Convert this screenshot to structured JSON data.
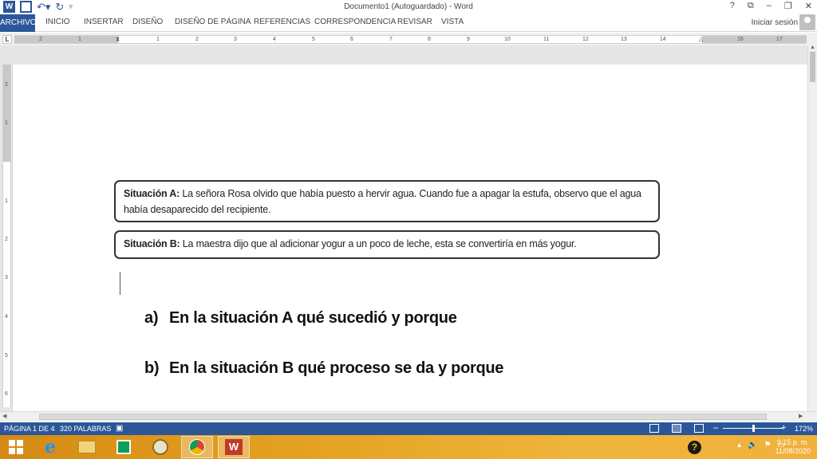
{
  "window": {
    "title": "Documento1 (Autoguardado) - Word",
    "controls": [
      "?",
      "⧉",
      "–",
      "❐",
      "✕"
    ]
  },
  "ribbon": {
    "file_tab": "ARCHIVO",
    "tabs": [
      "INICIO",
      "INSERTAR",
      "DISEÑO",
      "DISEÑO DE PÁGINA",
      "REFERENCIAS",
      "CORRESPONDENCIA",
      "REVISAR",
      "VISTA"
    ],
    "signin": "Iniciar sesión"
  },
  "ruler": {
    "tab_selector": "L",
    "left_numbers": [
      "2",
      "1"
    ],
    "numbers": [
      "1",
      "2",
      "3",
      "4",
      "5",
      "6",
      "7",
      "8",
      "9",
      "10",
      "11",
      "12",
      "13",
      "14",
      "15",
      "16",
      "17"
    ],
    "vertical_numbers": [
      "2",
      "1",
      "1",
      "2",
      "3",
      "4",
      "5",
      "6"
    ]
  },
  "document": {
    "situation_a_label": "Situación A:",
    "situation_a_text": " La señora Rosa olvido que había puesto a hervir agua. Cuando fue a apagar la estufa, observo que el agua había desaparecido del recipiente.",
    "situation_b_label": "Situación B:",
    "situation_b_text": " La maestra dijo que al adicionar yogur a un poco de leche, esta se convertiría en más yogur.",
    "question_a_letter": "a)",
    "question_a_text": "En la situación A qué sucedió y porque",
    "question_b_letter": "b)",
    "question_b_text": "En la situación B qué proceso se da y porque"
  },
  "statusbar": {
    "page": "PÁGINA 1 DE 4",
    "words": "320 PALABRAS",
    "zoom_minus": "–",
    "zoom_plus": "+",
    "zoom": "172%"
  },
  "taskbar": {
    "time": "9:15 p. m.",
    "date": "11/08/2020",
    "help": "?"
  }
}
